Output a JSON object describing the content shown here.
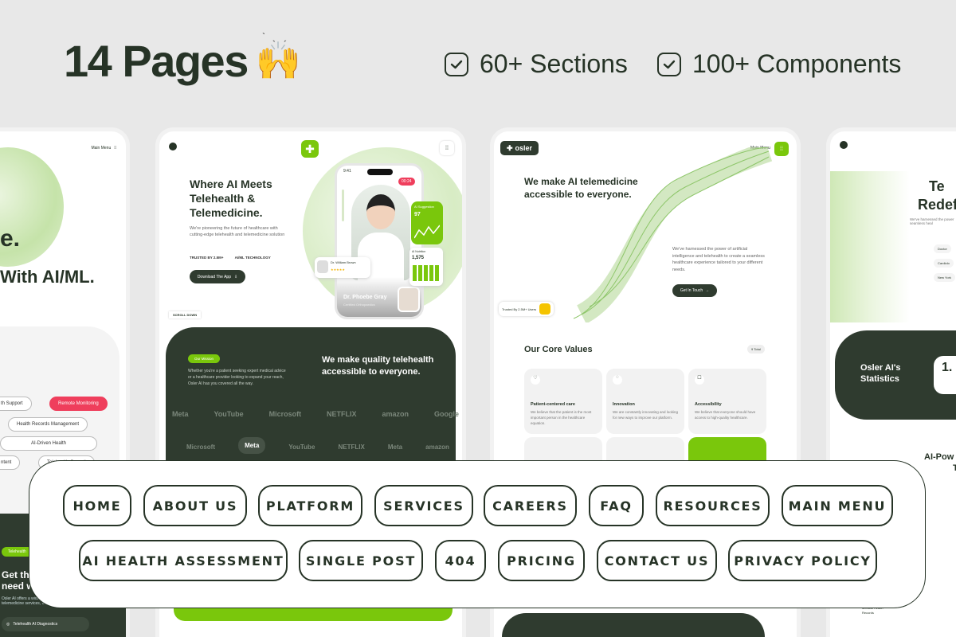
{
  "header": {
    "title": "14 Pages",
    "emoji": "🙌",
    "features": [
      "60+ Sections",
      "100+ Components"
    ]
  },
  "screen1": {
    "menu": "Main Menu",
    "headline_tail": "e.",
    "headline2": "With AI/ML.",
    "pills": [
      "th Support",
      "Remote Monitoring",
      "Health Records Management",
      "AI-Driven Health",
      "ntent",
      "Telehealth Consult"
    ],
    "tag": "Telehealth",
    "heading": "Get the\nneed wit",
    "body": "Osler AI offers a wide range o telemedicine services, including",
    "cta": "Telehealth AI Diagnostics"
  },
  "screen2": {
    "headline": [
      "Where AI Meets",
      "Telehealth &",
      "Telemedicine."
    ],
    "description": "We're pioneering the future of healthcare with cutting-edge telehealth and telemedicine solution",
    "trusted": "TRUSTED BY 2.5M+",
    "tech": "AI/ML TECHNOLOGY",
    "cta": "Download The App",
    "scroll": "SCROLL DOWN",
    "phone_time": "9:41",
    "call_time": "00:24",
    "ai_suggestion": "AI Suggestion",
    "ai_value": "97",
    "nutrition": "AI Nutrition",
    "nutrition_value": "1,575",
    "doctor_card": "Dr. William Brown",
    "doctor_name": "Dr. Phoebe Gray",
    "doctor_title": "Certified Orthopaedics",
    "mission_tag": "Our Mission",
    "mission_text": "Whether you're a patient seeking expert medical advice or a healthcare provider looking to expand your reach, Osler AI has you covered all the way.",
    "mission_heading": "We make quality telehealth accessible to everyone.",
    "logos_row1": [
      "Meta",
      "YouTube",
      "Microsoft",
      "NETFLIX",
      "amazon",
      "Google"
    ],
    "logos_row2": [
      "Microsoft",
      "Meta",
      "YouTube",
      "NETFLIX",
      "Meta",
      "amazon"
    ]
  },
  "screen3": {
    "logo": "osler",
    "menu": "Main Menu",
    "headline": "We make AI telemedicine accessible to everyone.",
    "description": "We've harnessed the power of artificial intelligence and telehealth to create a seamless healthcare experience tailored to your different needs.",
    "cta": "Get In Touch",
    "trusted": "Trusted By 2.5M+ Users",
    "values_title": "Our Core Values",
    "values_count": "9 Total",
    "values": [
      {
        "title": "Patient-centered care",
        "text": "We believe that the patient is the most important person in the healthcare equation."
      },
      {
        "title": "Innovation",
        "text": "We are constantly innovating and looking for new ways to improve our platform."
      },
      {
        "title": "Accessibility",
        "text": "We believe that everyone should have access to high-quality healthcare."
      }
    ]
  },
  "screen4": {
    "headline": [
      "Te",
      "Redef"
    ],
    "sub": "We've harnessed the power seamless heal",
    "items": [
      "Doctor",
      "Cardiolo",
      "New York"
    ],
    "stats_title": "Osler AI's Statistics",
    "stats_value": "1.",
    "section_title": [
      "AI-Pow",
      "Tele"
    ],
    "record": "Medical Health Records"
  },
  "pages_panel": {
    "row1": [
      "HOME",
      "ABOUT US",
      "PLATFORM",
      "SERVICES",
      "CAREERS",
      "FAQ",
      "RESOURCES",
      "MAIN MENU"
    ],
    "row2": [
      "AI HEALTH ASSESSMENT",
      "SINGLE POST",
      "404",
      "PRICING",
      "CONTACT US",
      "PRIVACY POLICY"
    ]
  },
  "colors": {
    "accent": "#7ac70c",
    "dark": "#2f3b2f",
    "text": "#263326",
    "red": "#ef3e5c"
  }
}
